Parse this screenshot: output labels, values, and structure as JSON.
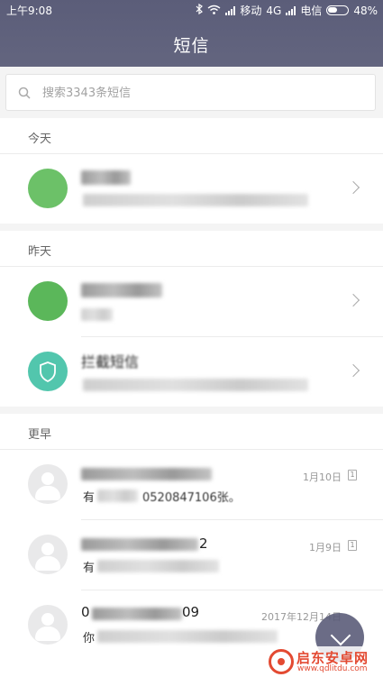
{
  "status_bar": {
    "time": "上午9:08",
    "carrier1": "移动",
    "network": "4G",
    "carrier2": "电信",
    "battery": "48%",
    "battery_level": 0.48
  },
  "header": {
    "title": "短信"
  },
  "search": {
    "placeholder": "搜索3343条短信"
  },
  "sections": {
    "today": "今天",
    "yesterday": "昨天",
    "earlier": "更早"
  },
  "conversations": [
    {
      "name": "",
      "preview": "",
      "date": ""
    },
    {
      "name": "",
      "preview": "",
      "date": ""
    },
    {
      "name": "拦截短信",
      "preview": "",
      "date": ""
    },
    {
      "name": "",
      "preview": "有",
      "preview_tail": "0520847106张。",
      "date": "1月10日"
    },
    {
      "name": "2",
      "preview": "有",
      "date": "1月9日"
    },
    {
      "name": "0",
      "name_tail": "09",
      "preview": "你",
      "date": "2017年12月14日"
    }
  ],
  "icons": {
    "bluetooth": "bluetooth-icon",
    "wifi": "wifi-icon",
    "search": "search-icon",
    "chevron": "chevron-right-icon",
    "sim": "sim-card-icon",
    "compose": "compose-icon"
  },
  "watermark": {
    "text": "启东安卓网",
    "url": "www.qdlitdu.com"
  },
  "colors": {
    "header": "#5b5d79",
    "avatar_green": "#6cc168",
    "avatar_teal": "#52c6ad",
    "watermark": "#e34a32"
  }
}
